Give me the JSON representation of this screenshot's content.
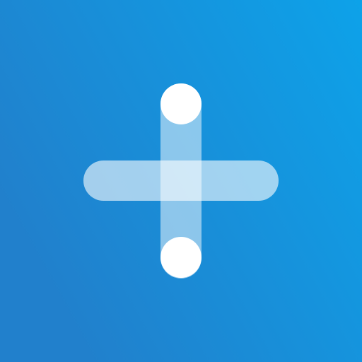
{
  "icon": {
    "name": "plus-icon",
    "gradient_start": "#0da2e9",
    "gradient_end": "#2180cc",
    "glyph_color": "#ffffff",
    "horizontal_bar_opacity": 0.6,
    "vertical_bar_opacity": 0.5
  }
}
